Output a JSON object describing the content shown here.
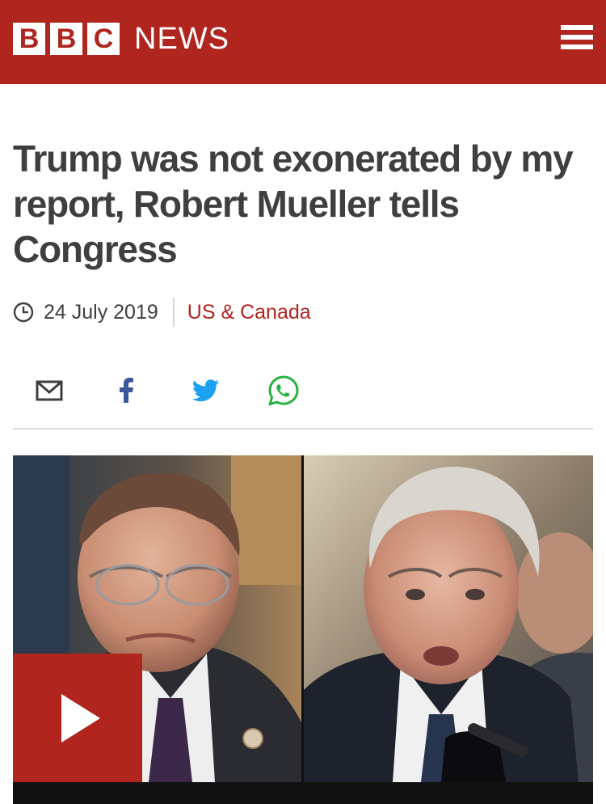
{
  "header": {
    "logo_letters": [
      "B",
      "B",
      "C"
    ],
    "logo_word": "NEWS",
    "menu_icon": "hamburger-menu-icon",
    "brand_color": "#b0251e"
  },
  "article": {
    "title": "Trump was not exonerated by my report, Robert Mueller tells Congress",
    "date": "24 July 2019",
    "section": "US & Canada",
    "date_icon": "clock-icon"
  },
  "share": {
    "icons": [
      "email-icon",
      "facebook-icon",
      "twitter-icon",
      "whatsapp-icon"
    ]
  },
  "media": {
    "play_icon": "play-icon",
    "photos": [
      "jerrold-nadler-photo",
      "robert-mueller-photo"
    ]
  }
}
